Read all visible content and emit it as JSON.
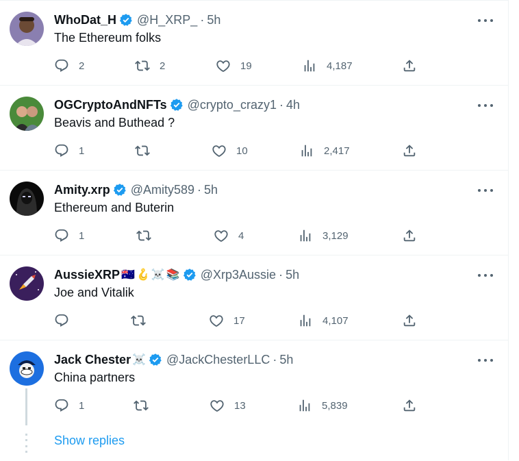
{
  "colors": {
    "accent": "#1d9bf0",
    "muted": "#536471",
    "text": "#0f1419",
    "border": "#eff3f4"
  },
  "tweets": [
    {
      "name": "WhoDat_H",
      "verified": true,
      "handle": "@H_XRP_",
      "time": "5h",
      "text": "The Ethereum folks",
      "replies": "2",
      "retweets": "2",
      "likes": "19",
      "views": "4,187",
      "avatar": "person-avatar-icon"
    },
    {
      "name": "OGCryptoAndNFTs",
      "verified": true,
      "handle": "@crypto_crazy1",
      "time": "4h",
      "text": "Beavis and Buthead ?",
      "replies": "1",
      "retweets": "",
      "likes": "10",
      "views": "2,417",
      "avatar": "couple-avatar-icon"
    },
    {
      "name": "Amity.xrp",
      "verified": true,
      "handle": "@Amity589",
      "time": "5h",
      "text": "Ethereum and Buterin",
      "replies": "1",
      "retweets": "",
      "likes": "4",
      "views": "3,129",
      "avatar": "hooded-figure-avatar-icon"
    },
    {
      "name": "AussieXRP",
      "emojis": [
        "🇦🇺",
        "🪝",
        "☠️",
        "📚"
      ],
      "verified": true,
      "handle": "@Xrp3Aussie",
      "time": "5h",
      "text": "Joe and Vitalik",
      "replies": "",
      "retweets": "",
      "likes": "17",
      "views": "4,107",
      "avatar": "rocket-avatar-icon"
    },
    {
      "name": "Jack Chester",
      "emojis": [
        "☠️"
      ],
      "verified": true,
      "handle": "@JackChesterLLC",
      "time": "5h",
      "text": "China partners",
      "replies": "1",
      "retweets": "",
      "likes": "13",
      "views": "5,839",
      "avatar": "pirate-avatar-icon"
    }
  ],
  "show_replies": "Show replies"
}
